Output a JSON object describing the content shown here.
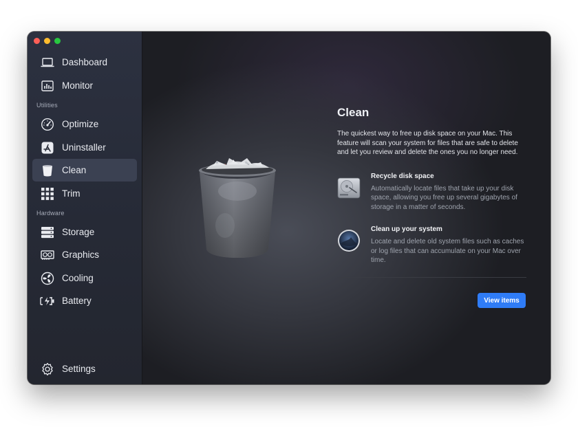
{
  "window": {
    "controls": [
      "close",
      "minimize",
      "zoom"
    ]
  },
  "sidebar": {
    "items": [
      {
        "label": "Dashboard",
        "icon": "laptop-icon"
      },
      {
        "label": "Monitor",
        "icon": "monitor-chart-icon"
      }
    ],
    "utilities_label": "Utilities",
    "utilities": [
      {
        "label": "Optimize",
        "icon": "speedometer-icon"
      },
      {
        "label": "Uninstaller",
        "icon": "app-store-icon"
      },
      {
        "label": "Clean",
        "icon": "trash-bin-icon",
        "active": true
      },
      {
        "label": "Trim",
        "icon": "grid-icon"
      }
    ],
    "hardware_label": "Hardware",
    "hardware": [
      {
        "label": "Storage",
        "icon": "storage-icon"
      },
      {
        "label": "Graphics",
        "icon": "graphics-card-icon"
      },
      {
        "label": "Cooling",
        "icon": "fan-icon"
      },
      {
        "label": "Battery",
        "icon": "battery-icon"
      }
    ],
    "settings": {
      "label": "Settings",
      "icon": "gear-icon"
    }
  },
  "main": {
    "title": "Clean",
    "intro": "The quickest way to free up disk space on your Mac. This feature will scan your system for files that are safe to delete and let you review and delete the ones you no longer need.",
    "features": [
      {
        "title": "Recycle disk space",
        "description": "Automatically locate files that take up your disk space, allowing you free up several gigabytes of storage in a matter of seconds.",
        "icon": "hard-drive-icon"
      },
      {
        "title": "Clean up your system",
        "description": "Locate and delete old system files such as caches or log files that can accumulate on your Mac over time.",
        "icon": "macos-disc-icon"
      }
    ],
    "button_label": "View items"
  },
  "colors": {
    "accent": "#2f7cf6",
    "sidebar_active": "#3b4152",
    "close": "#fe5f57",
    "minimize": "#febc2e",
    "zoom": "#28c840"
  }
}
